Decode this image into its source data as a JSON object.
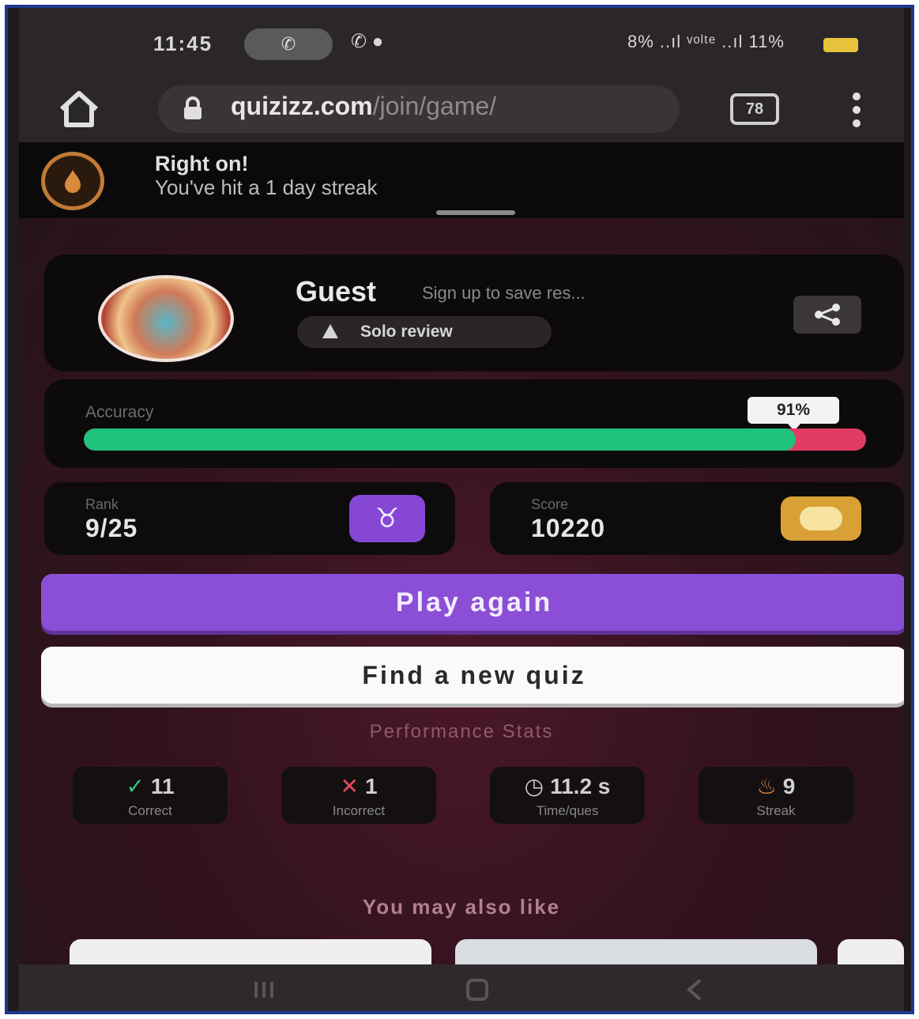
{
  "status_bar": {
    "time": "11:45",
    "right_text": "8% ..ıl ᵛᵒˡᵗᵉ ..ıl 11%"
  },
  "browser": {
    "url_host": "quizizz.com",
    "url_path": "/join/game/",
    "tabs_count": "78"
  },
  "streak_banner": {
    "title": "Right on!",
    "subtitle": "You've hit a 1 day streak"
  },
  "profile": {
    "name": "Guest",
    "hint": "Sign up to save res...",
    "mode_label": "Solo review"
  },
  "accuracy": {
    "label": "Accuracy",
    "value_label": "91%",
    "fraction": 0.91
  },
  "rank": {
    "label": "Rank",
    "value": "9/25",
    "badge_glyph": "♉"
  },
  "score": {
    "label": "Score",
    "value": "10220"
  },
  "buttons": {
    "play_again": "Play again",
    "find_quiz": "Find a new quiz"
  },
  "performance": {
    "title": "Performance Stats",
    "correct": {
      "value": "11",
      "label": "Correct"
    },
    "incorrect": {
      "value": "1",
      "label": "Incorrect"
    },
    "time": {
      "value": "11.2 s",
      "label": "Time/ques"
    },
    "streak": {
      "value": "9",
      "label": "Streak"
    }
  },
  "also_like": {
    "title": "You may also like"
  },
  "colors": {
    "accent_purple": "#8a4fd6",
    "accuracy_green": "#1fc27b",
    "accuracy_red": "#e23c62",
    "score_gold": "#d9a035"
  },
  "icons": [
    "home-icon",
    "lock-icon",
    "tabs-icon",
    "menu-icon",
    "streak-icon",
    "share-icon",
    "person-icon",
    "check-icon",
    "cross-icon",
    "timer-icon",
    "flame-icon"
  ]
}
